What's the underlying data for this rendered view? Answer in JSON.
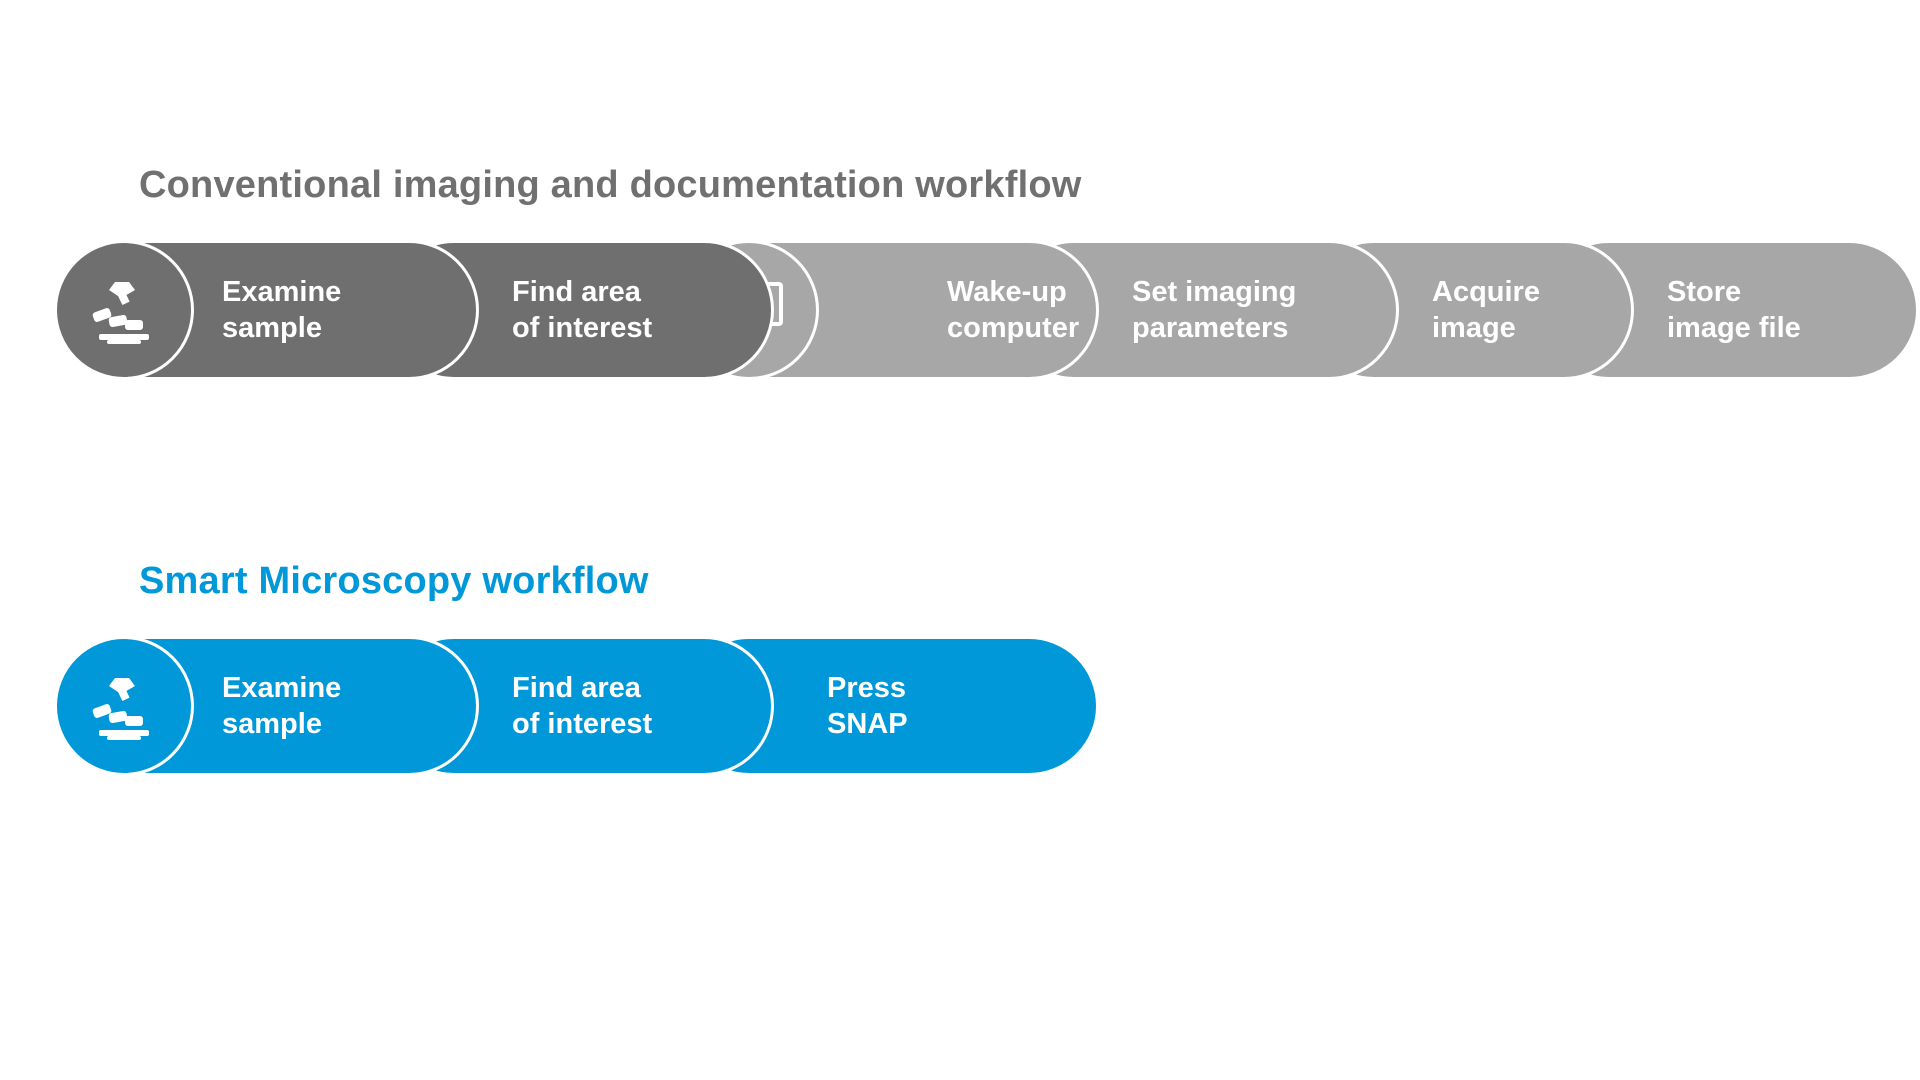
{
  "colors": {
    "dark_gray": "#6f6f6f",
    "light_gray": "#a7a7a7",
    "gray_title": "#707070",
    "blue": "#0098d8",
    "blue_title": "#0098d8",
    "white": "#ffffff"
  },
  "conventional": {
    "title": "Conventional imaging and documentation workflow",
    "icons": {
      "microscope": "microscope-icon",
      "monitor": "monitor-icon"
    },
    "steps": [
      {
        "id": "examine-sample",
        "label": "Examine\nsample"
      },
      {
        "id": "find-area",
        "label": "Find area\nof interest"
      },
      {
        "id": "wake-up",
        "label": "Wake-up\ncomputer"
      },
      {
        "id": "set-params",
        "label": "Set imaging\nparameters"
      },
      {
        "id": "acquire",
        "label": "Acquire\nimage"
      },
      {
        "id": "store",
        "label": "Store\nimage file"
      }
    ]
  },
  "smart": {
    "title": "Smart Microscopy workflow",
    "icons": {
      "microscope": "microscope-icon"
    },
    "steps": [
      {
        "id": "examine-sample",
        "label": "Examine\nsample"
      },
      {
        "id": "find-area",
        "label": "Find area\nof interest"
      },
      {
        "id": "snap",
        "label": "Press\nSNAP"
      }
    ]
  }
}
